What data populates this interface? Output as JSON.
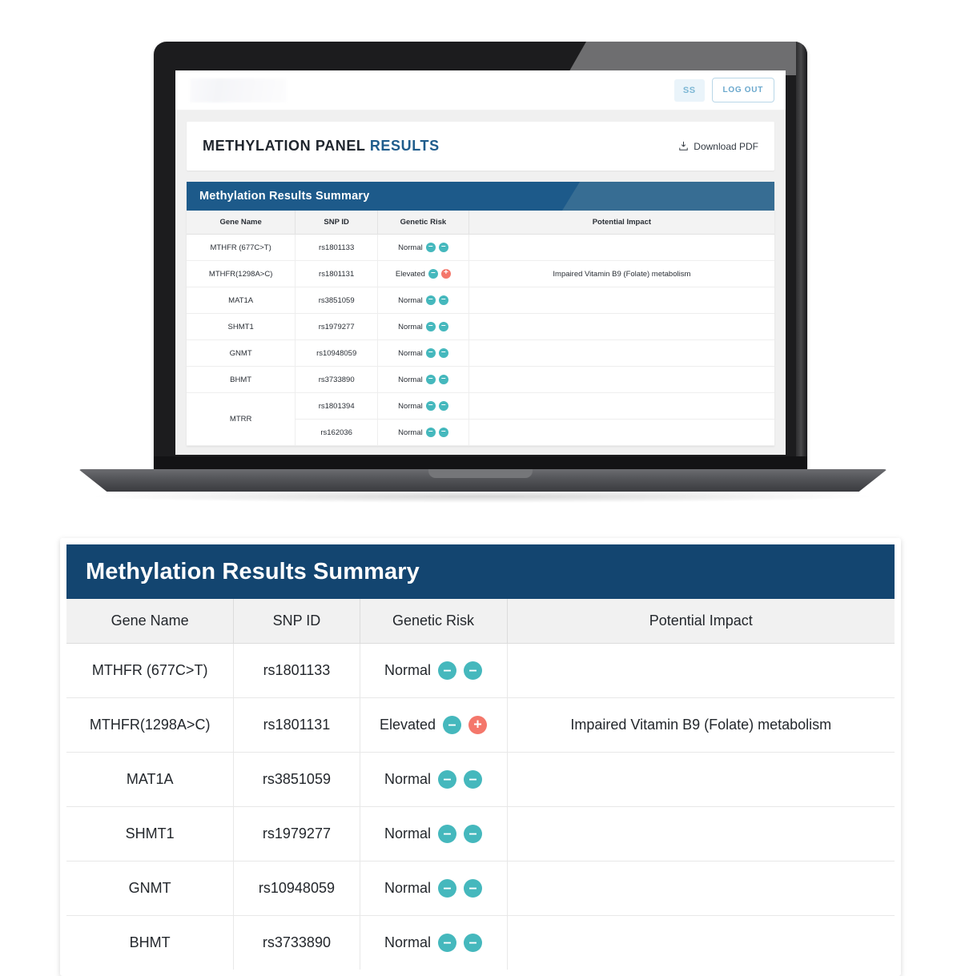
{
  "app": {
    "topbar": {
      "logo_name": "brand-logo",
      "avatar_initials": "SS",
      "logout_label": "LOG OUT"
    },
    "panel": {
      "title_main": "METHYLATION PANEL ",
      "title_accent": "RESULTS",
      "download_label": "Download PDF",
      "download_icon": "download-icon"
    }
  },
  "colors": {
    "header_navy": "#134570",
    "header_navy_screen": "#1d5a8a",
    "header_steel": "#376d93",
    "badge_normal": "#45b8bd",
    "badge_elevated": "#f4776b",
    "accent_blue": "#1f5c8c"
  },
  "table": {
    "title": "Methylation Results Summary",
    "columns": [
      "Gene Name",
      "SNP ID",
      "Genetic Risk",
      "Potential Impact"
    ],
    "rows": [
      {
        "gene": "MTHFR (677C>T)",
        "snp": "rs1801133",
        "risk": "Normal",
        "badges": [
          "minus",
          "minus"
        ],
        "impact": ""
      },
      {
        "gene": "MTHFR(1298A>C)",
        "snp": "rs1801131",
        "risk": "Elevated",
        "badges": [
          "minus",
          "plus"
        ],
        "impact": "Impaired Vitamin B9 (Folate) metabolism"
      },
      {
        "gene": "MAT1A",
        "snp": "rs3851059",
        "risk": "Normal",
        "badges": [
          "minus",
          "minus"
        ],
        "impact": ""
      },
      {
        "gene": "SHMT1",
        "snp": "rs1979277",
        "risk": "Normal",
        "badges": [
          "minus",
          "minus"
        ],
        "impact": ""
      },
      {
        "gene": "GNMT",
        "snp": "rs10948059",
        "risk": "Normal",
        "badges": [
          "minus",
          "minus"
        ],
        "impact": ""
      },
      {
        "gene": "BHMT",
        "snp": "rs3733890",
        "risk": "Normal",
        "badges": [
          "minus",
          "minus"
        ],
        "impact": ""
      }
    ],
    "screen_extra_rows": [
      {
        "gene": "MTRR",
        "rowspan": 2,
        "snp": "rs1801394",
        "risk": "Normal",
        "badges": [
          "minus",
          "minus"
        ],
        "impact": ""
      },
      {
        "gene": "",
        "rowspan": 0,
        "snp": "rs162036",
        "risk": "Normal",
        "badges": [
          "minus",
          "minus"
        ],
        "impact": ""
      }
    ]
  },
  "badge_glyphs": {
    "minus": "–",
    "plus": "+"
  }
}
